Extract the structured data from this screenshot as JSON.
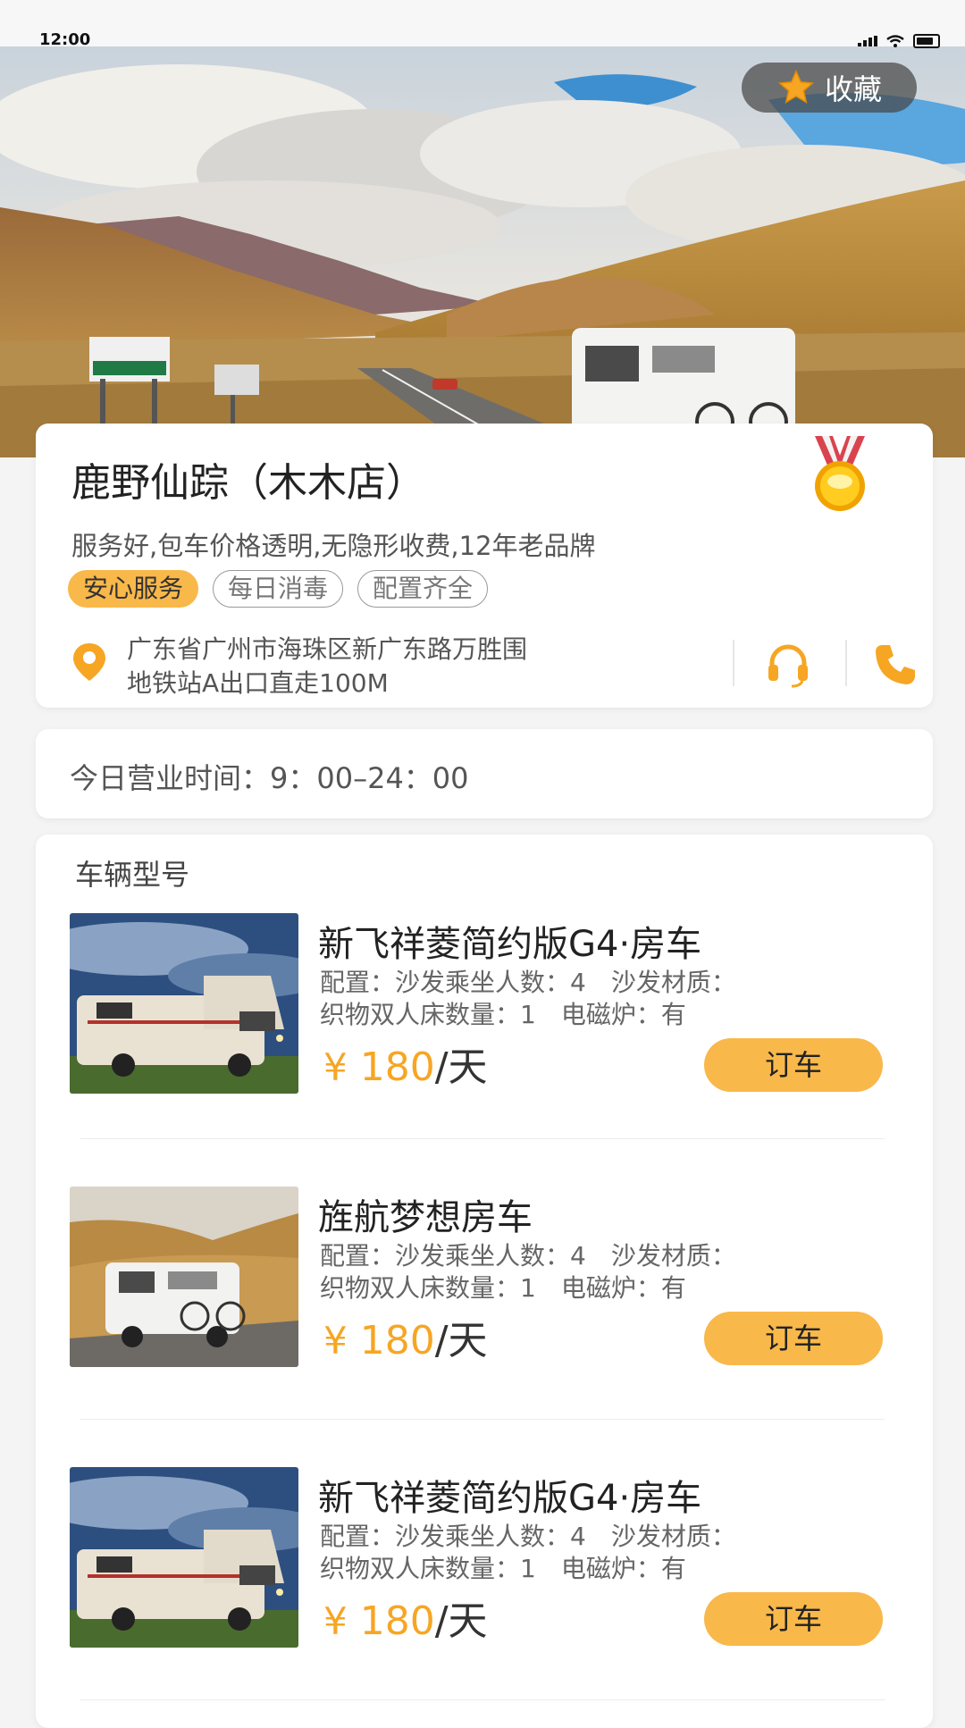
{
  "status_bar": {
    "time": "12:00"
  },
  "hero": {
    "favorite_label": "收藏"
  },
  "shop": {
    "name": "鹿野仙踪（木木店）",
    "description": "服务好,包车价格透明,无隐形收费,12年老品牌",
    "tags": [
      "安心服务",
      "每日消毒",
      "配置齐全"
    ],
    "address_line1": "广东省广州市海珠区新广东路万胜围",
    "address_line2": "地铁站A出口直走100M"
  },
  "hours": {
    "text": "今日营业时间：9：00–24：00"
  },
  "vehicles": {
    "section_title": "车辆型号",
    "items": [
      {
        "name": "新飞祥菱简约版G4·房车",
        "specs_line1": "配置：沙发乘坐人数：4　沙发材质：",
        "specs_line2": "织物双人床数量：1　电磁炉：有",
        "price_symbol": "¥",
        "price_value": "180",
        "price_unit": "/天",
        "book_label": "订车"
      },
      {
        "name": "旌航梦想房车",
        "specs_line1": "配置：沙发乘坐人数：4　沙发材质：",
        "specs_line2": "织物双人床数量：1　电磁炉：有",
        "price_symbol": "¥",
        "price_value": "180",
        "price_unit": "/天",
        "book_label": "订车"
      },
      {
        "name": "新飞祥菱简约版G4·房车",
        "specs_line1": "配置：沙发乘坐人数：4　沙发材质：",
        "specs_line2": "织物双人床数量：1　电磁炉：有",
        "price_symbol": "¥",
        "price_value": "180",
        "price_unit": "/天",
        "book_label": "订车"
      }
    ]
  },
  "colors": {
    "accent": "#f9b84a",
    "price": "#f6a623"
  }
}
